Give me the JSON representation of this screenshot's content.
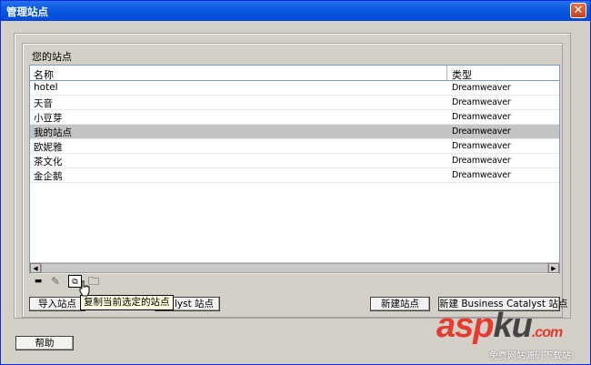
{
  "window": {
    "title": "管理站点",
    "close_glyph": "✕"
  },
  "group": {
    "label": "您的站点"
  },
  "table": {
    "columns": [
      "名称",
      "类型"
    ],
    "rows": [
      {
        "name": "hotel",
        "type": "Dreamweaver",
        "selected": false
      },
      {
        "name": "天音",
        "type": "Dreamweaver",
        "selected": false
      },
      {
        "name": "小豆芽",
        "type": "Dreamweaver",
        "selected": false
      },
      {
        "name": "我的站点",
        "type": "Dreamweaver",
        "selected": true
      },
      {
        "name": "欧妮雅",
        "type": "Dreamweaver",
        "selected": false
      },
      {
        "name": "茶文化",
        "type": "Dreamweaver",
        "selected": false
      },
      {
        "name": "金企鹅",
        "type": "Dreamweaver",
        "selected": false
      }
    ]
  },
  "toolbar": {
    "remove_glyph": "▬",
    "edit_glyph": "✎",
    "duplicate_glyph": "⧉",
    "export_glyph": "🗀"
  },
  "tooltip": "复制当前选定的站点",
  "buttons": {
    "import_site": "导入站点",
    "import_catalyst_partial": "atalyst 站点",
    "new_site": "新建站点",
    "new_bc_site": "新建 Business Catalyst 站点",
    "help": "帮助"
  },
  "watermark": {
    "main_a": "asp",
    "main_b": "ku",
    "dot_com": ".com",
    "sub": "免费网站源码下载站!"
  }
}
